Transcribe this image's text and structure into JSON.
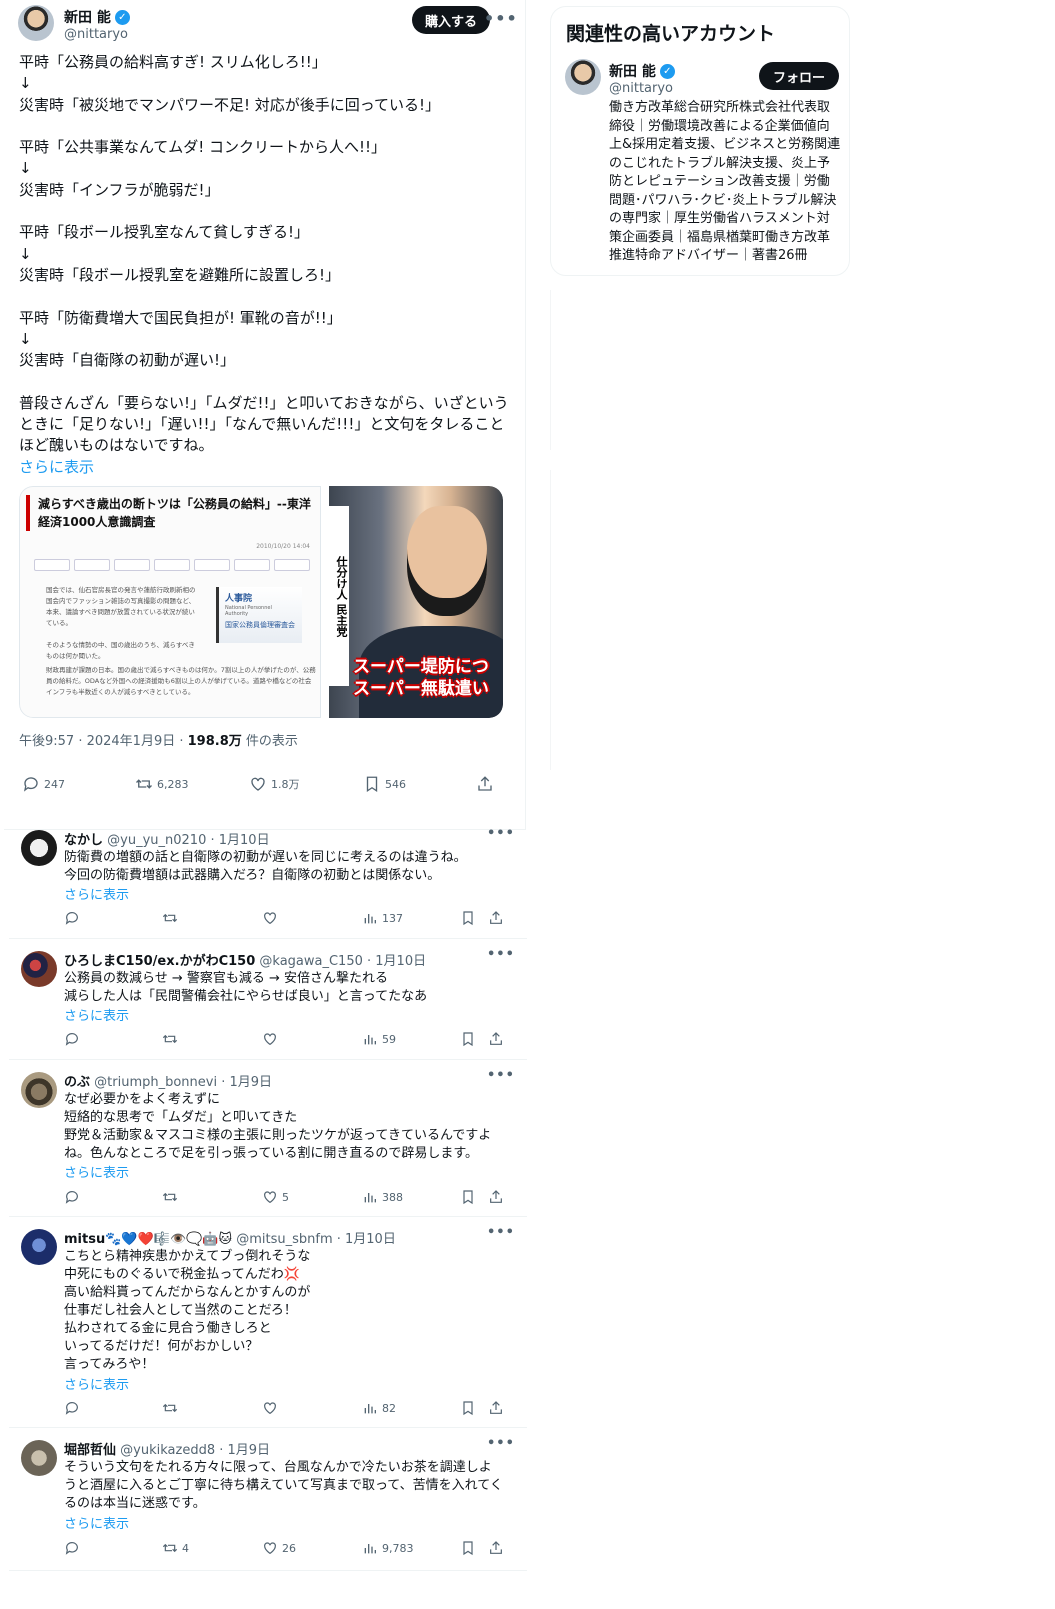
{
  "main_tweet": {
    "author_name": "新田 能",
    "author_handle": "@nittaryo",
    "buy_label": "購入する",
    "more": "•••",
    "body": "平時「公務員の給料高すぎ! スリム化しろ!!」\n↓\n災害時「被災地でマンパワー不足! 対応が後手に回っている!」\n\n平時「公共事業なんてムダ! コンクリートから人へ!!」\n↓\n災害時「インフラが脆弱だ!」\n\n平時「段ボール授乳室なんて貧しすぎる!」\n↓\n災害時「段ボール授乳室を避難所に設置しろ!」\n\n平時「防衛費増大で国民負担が! 軍靴の音が!!」\n↓\n災害時「自衛隊の初動が遅い!」\n\n普段さんざん「要らない!」「ムダだ!!」と叩いておきながら、いざというときに「足りない!」「遅い!!」「なんで無いんだ!!!」と文句をタレること ほど醜いものはないですね。",
    "show_more": "さらに表示",
    "media": {
      "news_headline": "減らすべき歳出の断トツは「公務員の給料」--東洋経済1000人意識調査",
      "news_date": "2010/10/20 14:04",
      "news_paragraph_1": "国会では、仙石官房長官の発言や蓮舫行政刷新相の国会内でファッション雑誌の写真撮影の問題など、本来、議論すべき問題が放置されている状況が続いている。\n\nそのような情勢の中、国の歳出のうち、減らすべきものは何か聞いた。",
      "news_sign_title": "人事院",
      "news_sign_sub": "National Personnel Authority",
      "news_sign_sub2": "国家公務員倫理審査会",
      "news_paragraph_2": "財政再建が課題の日本。国の歳出で減らすべきものは何か。7割以上の人が挙げたのが、公務員の給料だ。ODAなど外国への経済援助も6割以上の人が挙げている。道路や橋などの社会インフラも半数近くの人が減らすべきとしている。",
      "tv_band": "仕分け人 民主党",
      "tv_caption_1": "スーパー堤防につ",
      "tv_caption_2": "スーパー無駄遣い"
    },
    "time": "午後9:57 · 2024年1月9日 · ",
    "views": "198.8万",
    "views_suffix": " 件の表示",
    "stats": {
      "replies": "247",
      "retweets": "6,283",
      "likes": "1.8万",
      "bookmarks": "546"
    }
  },
  "replies": [
    {
      "name": "なかし",
      "handle": "@yu_yu_n0210",
      "date": "· 1月10日",
      "text": "防衛費の増額の話と自衛隊の初動が遅いを同じに考えるのは違うね。\n今回の防衛費増額は武器購入だろ？自衛隊の初動とは関係ない。",
      "show_more": "さらに表示",
      "retweets": "",
      "likes": "",
      "views": "137"
    },
    {
      "name": "ひろしまC150/ex.かがわC150",
      "handle": "@kagawa_C150",
      "date": "· 1月10日",
      "text": "公務員の数減らせ → 警察官も減る → 安倍さん撃たれる\n減らした人は「民間警備会社にやらせば良い」と言ってたなあ",
      "show_more": "さらに表示",
      "retweets": "",
      "likes": "",
      "views": "59"
    },
    {
      "name": "のぶ",
      "handle": "@triumph_bonnevi",
      "date": "· 1月9日",
      "text": "なぜ必要かをよく考えずに\n短絡的な思考で「ムダだ」と叩いてきた\n野党＆活動家＆マスコミ様の主張に則ったツケが返ってきているんですよね。色んなところで足を引っ張っている割に開き直るので辟易します。",
      "show_more": "さらに表示",
      "retweets": "",
      "likes": "5",
      "views": "388"
    },
    {
      "name": "mitsu",
      "name_emoji": "🐾💙❤️🎼👁️🗨️🤖🐱",
      "handle": "@mitsu_sbnfm",
      "date": "· 1月10日",
      "text": "こちとら精神疾患かかえてブっ倒れそうな\n中死にものぐるいで税金払ってんだわ💢\n高い給料貰ってんだからなんとかすんのが\n仕事だし社会人として当然のことだろ！\n払わされてる金に見合う働きしろと\nいってるだけだ！何がおかしい？\n言ってみろや！",
      "show_more": "さらに表示",
      "retweets": "",
      "likes": "",
      "views": "82"
    },
    {
      "name": "堀部哲仙",
      "handle": "@yukikazedd8",
      "date": "· 1月9日",
      "text": "そういう文句をたれる方々に限って、台風なんかで冷たいお茶を調達しようと酒屋に入るとご丁寧に待ち構えていて写真まで取って、苦情を入れてくるのは本当に迷惑です。",
      "show_more": "さらに表示",
      "retweets": "4",
      "likes": "26",
      "views": "9,783"
    }
  ],
  "sidebar": {
    "title": "関連性の高いアカウント",
    "name": "新田 能",
    "handle": "@nittaryo",
    "follow_label": "フォロー",
    "bio": "働き方改革総合研究所株式会社代表取締役｜労働環境改善による企業価値向上&採用定着支援、ビジネスと労務関連のこじれたトラブル解決支援、炎上予防とレピュテーション改善支援｜労働問題･パワハラ･クビ･炎上トラブル解決の専門家｜厚生労働省ハラスメント対策企画委員｜福島県楢葉町働き方改革推進特命アドバイザー｜著書26冊"
  },
  "colors": {
    "accent": "#1d9bf0",
    "text": "#0f1419",
    "muted": "#536471",
    "border": "#eff3f4"
  },
  "icons": [
    "verified-icon",
    "more-icon",
    "reply-icon",
    "retweet-icon",
    "like-icon",
    "views-icon",
    "bookmark-icon",
    "share-icon"
  ]
}
